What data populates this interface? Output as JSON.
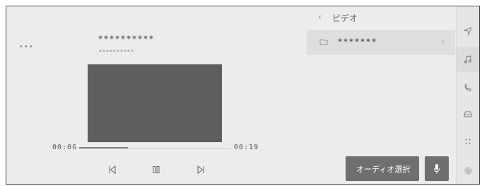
{
  "player": {
    "more_label": "•••",
    "title": "**********",
    "subtitle": "**********",
    "current_time": "00:06",
    "duration": "00:19",
    "progress": 0.32
  },
  "browser": {
    "back_label": "‹",
    "breadcrumb": "ビデオ",
    "folder_name": "*******",
    "folder_chevron": "›"
  },
  "actions": {
    "audio_select_label": "オーディオ選択",
    "audio_select_indicator": "=",
    "mic_icon": "mic-icon"
  },
  "rail": {
    "icons": [
      "navigation-icon",
      "music-icon",
      "phone-icon",
      "car-icon",
      "apps-icon",
      "settings-icon"
    ],
    "active": "music-icon"
  },
  "colors": {
    "screen_bg": "#ececec",
    "video_bg": "#5e5e5e",
    "button_bg": "#6f6f6f"
  }
}
